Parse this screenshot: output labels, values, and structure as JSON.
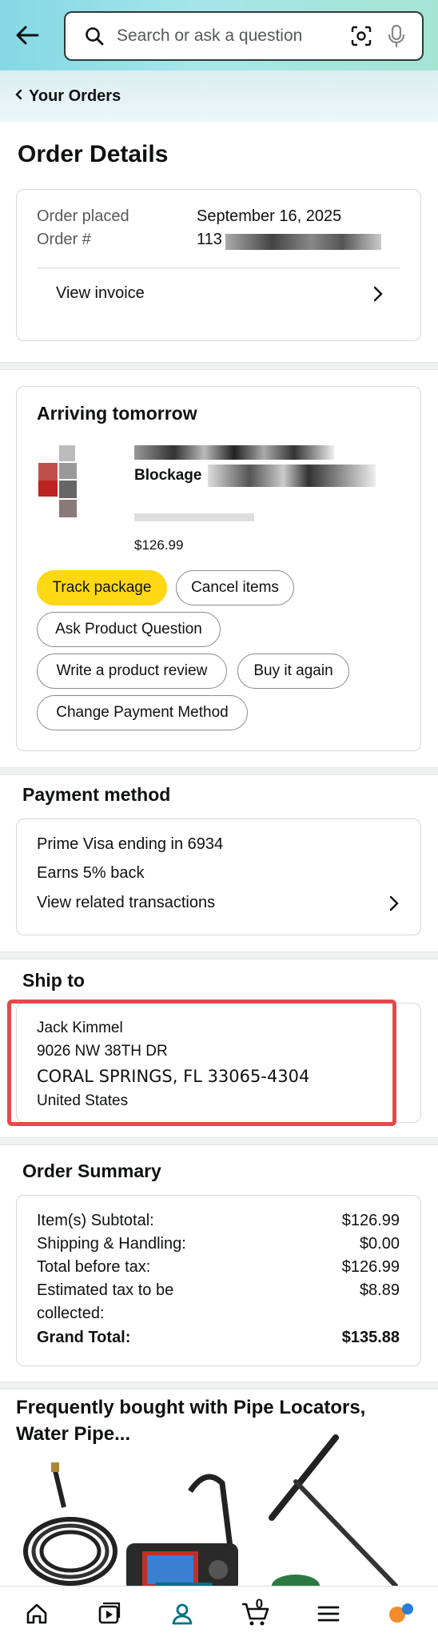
{
  "header": {
    "search_placeholder": "Search or ask a question"
  },
  "breadcrumb": {
    "label": "Your Orders"
  },
  "page_title": "Order Details",
  "order_info": {
    "placed_label": "Order placed",
    "placed_value": "September 16, 2025",
    "number_label": "Order #",
    "number_value": "113",
    "invoice_label": "View invoice"
  },
  "shipment": {
    "status": "Arriving tomorrow",
    "item_title_visible": "Blockage",
    "price": "$126.99",
    "buttons": {
      "track": "Track package",
      "cancel": "Cancel items",
      "ask": "Ask Product Question",
      "review": "Write a product review",
      "buy_again": "Buy it again",
      "change_payment": "Change Payment Method"
    }
  },
  "payment": {
    "heading": "Payment method",
    "card": "Prime Visa  ending in 6934",
    "earns": "Earns 5% back",
    "transactions_link": "View related transactions"
  },
  "ship_to": {
    "heading": "Ship to",
    "name": "Jack Kimmel",
    "street": "9026 NW 38TH DR",
    "city": "CORAL SPRINGS, FL 33065-4304",
    "country": "United States"
  },
  "summary": {
    "heading": "Order Summary",
    "rows": [
      {
        "label": "Item(s) Subtotal:",
        "value": "$126.99"
      },
      {
        "label": "Shipping & Handling:",
        "value": "$0.00"
      },
      {
        "label": "Total before tax:",
        "value": "$126.99"
      },
      {
        "label": "Estimated tax to be",
        "label2": "collected:",
        "value": "$8.89"
      },
      {
        "label": "Grand Total:",
        "value": "$135.88"
      }
    ]
  },
  "frequently_bought": {
    "heading_line1": "Frequently bought with Pipe Locators,",
    "heading_line2": "Water Pipe..."
  },
  "bottom_nav": {
    "cart_count": "0",
    "active": "account",
    "accent": "#007185"
  },
  "colors": {
    "primary_button": "#ffd814",
    "highlight_border": "#e5484d"
  }
}
